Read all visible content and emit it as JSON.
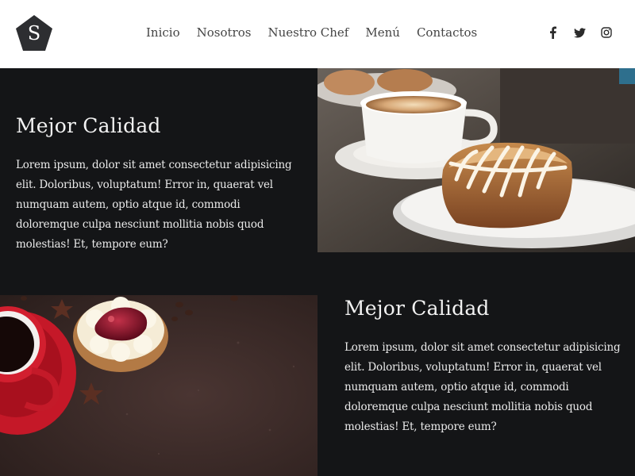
{
  "header": {
    "logo_letter": "S",
    "nav": [
      "Inicio",
      "Nosotros",
      "Nuestro Chef",
      "Menú",
      "Contactos"
    ],
    "social": [
      "facebook-icon",
      "twitter-icon",
      "instagram-icon"
    ]
  },
  "sections": [
    {
      "title": "Mejor Calidad",
      "body": "Lorem ipsum, dolor sit amet consectetur adipisicing elit. Doloribus, voluptatum! Error in, quaerat vel numquam autem, optio atque id, commodi doloremque culpa nesciunt mollitia nobis quod molestias! Et, tempore eum?"
    },
    {
      "title": "Mejor Calidad",
      "body": "Lorem ipsum, dolor sit amet consectetur adipisicing elit. Doloribus, voluptatum! Error in, quaerat vel numquam autem, optio atque id, commodi doloremque culpa nesciunt mollitia nobis quod molestias! Et, tempore eum?"
    }
  ],
  "colors": {
    "header_bg": "#ffffff",
    "page_bg": "#141517",
    "logo": "#2d2e31",
    "nav_text": "#444444",
    "heading": "#f2f2f2"
  }
}
